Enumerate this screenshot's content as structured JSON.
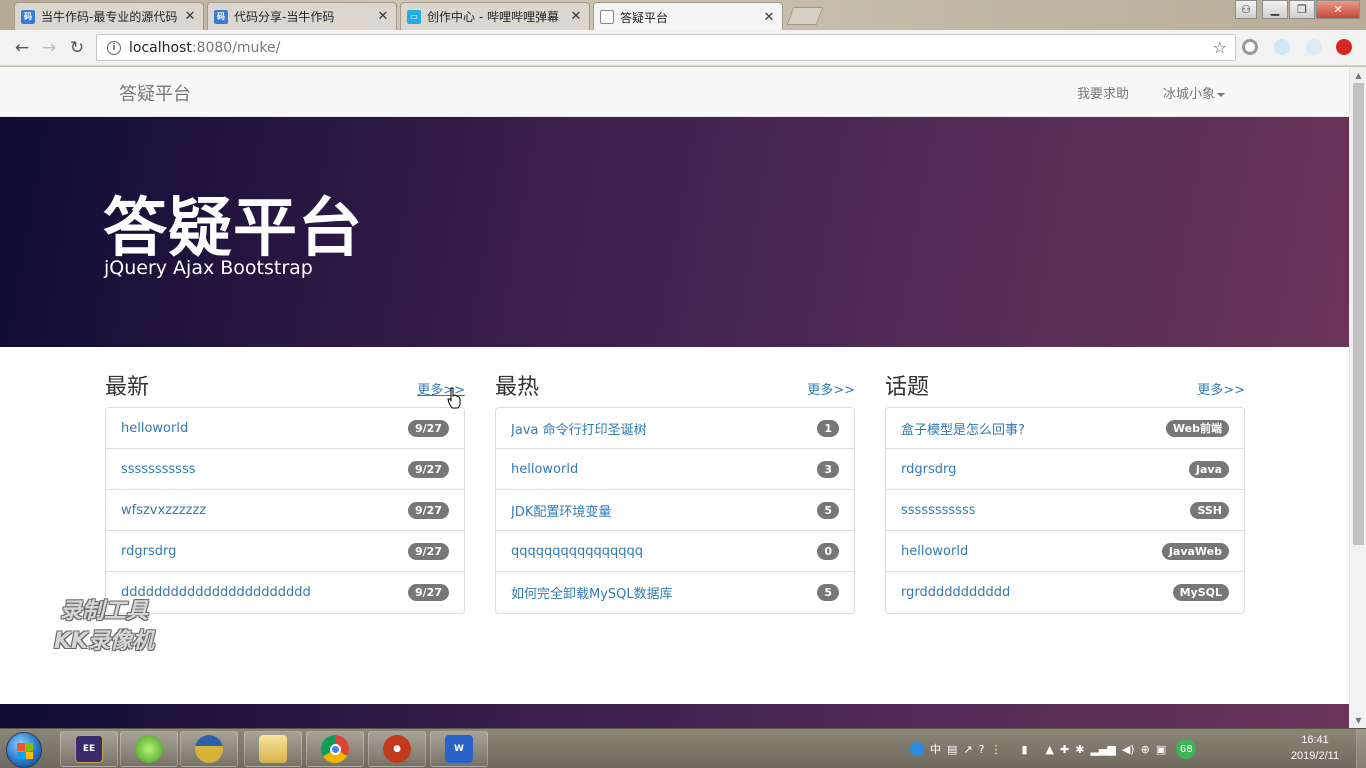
{
  "browser": {
    "tabs": [
      {
        "label": "当牛作码-最专业的源代码",
        "icon_color": "#3a7bd5"
      },
      {
        "label": "代码分享-当牛作码",
        "icon_color": "#3a7bd5"
      },
      {
        "label": "创作中心 - 哔哩哔哩弹幕",
        "icon_color": "#23ade5"
      },
      {
        "label": "答疑平台",
        "icon_color": "#ffffff"
      }
    ],
    "address": {
      "host": "localhost",
      "rest": ":8080/muke/"
    }
  },
  "site": {
    "brand": "答疑平台",
    "nav": {
      "help": "我要求助",
      "user": "冰城小象"
    },
    "hero": {
      "title": "答疑平台",
      "subtitle": "jQuery Ajax Bootstrap"
    },
    "more_label": "更多>>",
    "columns": [
      {
        "title": "最新",
        "items": [
          {
            "text": "helloworld",
            "badge": "9/27"
          },
          {
            "text": "sssssssssss",
            "badge": "9/27"
          },
          {
            "text": "wfszvxzzzzzz",
            "badge": "9/27"
          },
          {
            "text": "rdgrsdrg",
            "badge": "9/27"
          },
          {
            "text": "ddddddddddddddddddddddd",
            "badge": "9/27"
          }
        ]
      },
      {
        "title": "最热",
        "items": [
          {
            "text": "Java 命令行打印圣诞树",
            "badge": "1"
          },
          {
            "text": "helloworld",
            "badge": "3"
          },
          {
            "text": "JDK配置环境变量",
            "badge": "5"
          },
          {
            "text": "qqqqqqqqqqqqqqqq",
            "badge": "0"
          },
          {
            "text": "如何完全卸载MySQL数据库",
            "badge": "5"
          }
        ]
      },
      {
        "title": "话题",
        "items": [
          {
            "text": "盒子模型是怎么回事?",
            "badge": "Web前端"
          },
          {
            "text": "rdgrsdrg",
            "badge": "Java"
          },
          {
            "text": "sssssssssss",
            "badge": "SSH"
          },
          {
            "text": "helloworld",
            "badge": "JavaWeb"
          },
          {
            "text": "rgrddddddddddd",
            "badge": "MySQL"
          }
        ]
      }
    ]
  },
  "watermark": {
    "line1": "录制工具",
    "line2": "KK录像机"
  },
  "taskbar": {
    "tray_ime": "中",
    "tray_badge": "68",
    "clock_time": "16:41",
    "clock_date": "2019/2/11"
  }
}
